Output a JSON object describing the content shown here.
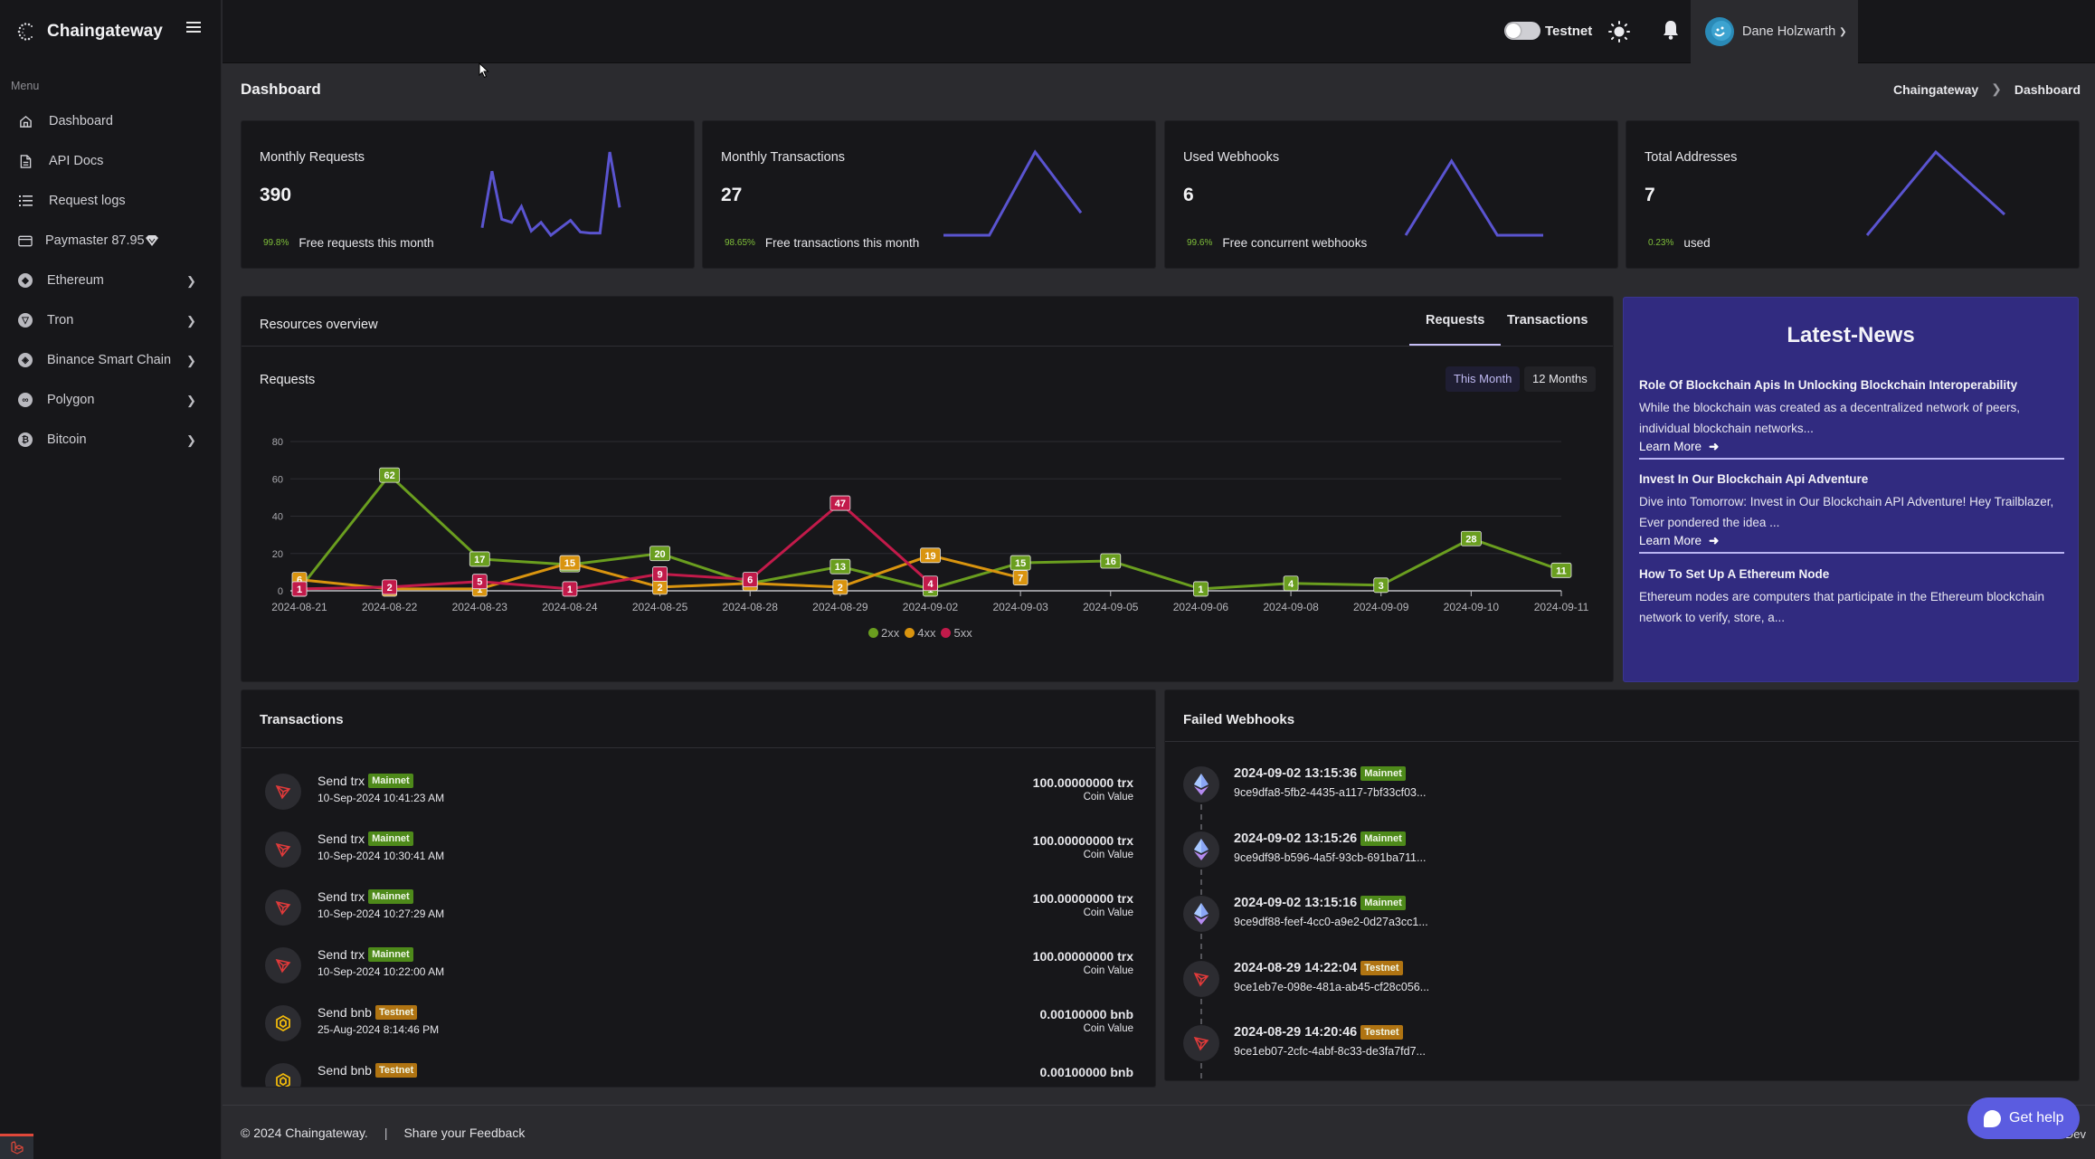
{
  "app": {
    "name": "Chaingateway"
  },
  "sidebar": {
    "menu_label": "Menu",
    "items": [
      {
        "label": "Dashboard",
        "icon": "home-icon",
        "has_submenu": false
      },
      {
        "label": "API Docs",
        "icon": "document-icon",
        "has_submenu": false
      },
      {
        "label": "Request logs",
        "icon": "list-icon",
        "has_submenu": false
      },
      {
        "label": "Paymaster 87.95",
        "icon": "credit-card-icon",
        "suffix_icon": "tron-diamond-icon",
        "has_submenu": false
      },
      {
        "label": "Ethereum",
        "icon": "ethereum-icon",
        "has_submenu": true
      },
      {
        "label": "Tron",
        "icon": "tron-icon",
        "has_submenu": true
      },
      {
        "label": "Binance Smart Chain",
        "icon": "bnb-icon",
        "has_submenu": true
      },
      {
        "label": "Polygon",
        "icon": "polygon-icon",
        "has_submenu": true
      },
      {
        "label": "Bitcoin",
        "icon": "bitcoin-icon",
        "has_submenu": true
      }
    ]
  },
  "topbar": {
    "network_toggle_label": "Testnet",
    "network_toggle_on": false,
    "user_name": "Dane Holzwarth"
  },
  "page": {
    "title": "Dashboard",
    "breadcrumb": [
      "Chaingateway",
      "Dashboard"
    ]
  },
  "stats": [
    {
      "title": "Monthly Requests",
      "value": "390",
      "pct": "99.8%",
      "desc": "Free requests this month",
      "spark": [
        9,
        62,
        17,
        14,
        29,
        6,
        14,
        2,
        9,
        16,
        5,
        4,
        4,
        80,
        28
      ]
    },
    {
      "title": "Monthly Transactions",
      "value": "27",
      "pct": "98.65%",
      "desc": "Free transactions this month",
      "spark": [
        0,
        0,
        26,
        7
      ]
    },
    {
      "title": "Used Webhooks",
      "value": "6",
      "pct": "99.6%",
      "desc": "Free concurrent webhooks",
      "spark": [
        0,
        3,
        0,
        0
      ]
    },
    {
      "title": "Total Addresses",
      "value": "7",
      "pct": "0.23%",
      "desc": "used",
      "spark": [
        1,
        5,
        2
      ]
    }
  ],
  "resources": {
    "title": "Resources overview",
    "tabs": [
      "Requests",
      "Transactions"
    ],
    "active_tab": "Requests",
    "subtitle": "Requests",
    "ranges": [
      "This Month",
      "12 Months"
    ],
    "active_range": "This Month"
  },
  "chart_data": {
    "type": "line",
    "title": "Requests",
    "xlabel": "",
    "ylabel": "",
    "ylim": [
      0,
      80
    ],
    "yticks": [
      0,
      20,
      40,
      60,
      80
    ],
    "grid": true,
    "legend": "bottom-center",
    "categories": [
      "2024-08-21",
      "2024-08-22",
      "2024-08-23",
      "2024-08-24",
      "2024-08-25",
      "2024-08-28",
      "2024-08-29",
      "2024-09-02",
      "2024-09-03",
      "2024-09-05",
      "2024-09-06",
      "2024-09-08",
      "2024-09-09",
      "2024-09-10",
      "2024-09-11"
    ],
    "series": [
      {
        "name": "2xx",
        "color": "#6a9e1f",
        "values": [
          1,
          62,
          17,
          14,
          20,
          4,
          13,
          1,
          15,
          16,
          1,
          4,
          3,
          28,
          11
        ]
      },
      {
        "name": "4xx",
        "color": "#d9940f",
        "values": [
          6,
          1,
          1,
          15,
          2,
          4,
          2,
          19,
          7,
          null,
          null,
          null,
          null,
          null,
          null
        ]
      },
      {
        "name": "5xx",
        "color": "#c21a4a",
        "values": [
          1,
          2,
          5,
          1,
          9,
          6,
          47,
          4,
          null,
          null,
          null,
          null,
          null,
          null,
          null
        ]
      }
    ]
  },
  "news": {
    "title": "Latest-News",
    "items": [
      {
        "title": "Role Of Blockchain Apis In Unlocking Blockchain Interoperability",
        "excerpt": "While the blockchain was created as a decentralized network of peers, individual blockchain networks...",
        "link": "Learn More"
      },
      {
        "title": "Invest In Our Blockchain Api Adventure",
        "excerpt": "Dive into Tomorrow: Invest in Our Blockchain API Adventure! Hey Trailblazer, Ever pondered the idea ...",
        "link": "Learn More"
      },
      {
        "title": "How To Set Up A Ethereum Node",
        "excerpt": "Ethereum nodes are computers that participate in the Ethereum blockchain network to verify, store, a..."
      }
    ]
  },
  "transactions": {
    "title": "Transactions",
    "items": [
      {
        "coin": "tron",
        "title": "Send trx",
        "network": "Mainnet",
        "time": "10-Sep-2024 10:41:23 AM",
        "amount": "100.00000000 trx",
        "sub": "Coin Value"
      },
      {
        "coin": "tron",
        "title": "Send trx",
        "network": "Mainnet",
        "time": "10-Sep-2024 10:30:41 AM",
        "amount": "100.00000000 trx",
        "sub": "Coin Value"
      },
      {
        "coin": "tron",
        "title": "Send trx",
        "network": "Mainnet",
        "time": "10-Sep-2024 10:27:29 AM",
        "amount": "100.00000000 trx",
        "sub": "Coin Value"
      },
      {
        "coin": "tron",
        "title": "Send trx",
        "network": "Mainnet",
        "time": "10-Sep-2024 10:22:00 AM",
        "amount": "100.00000000 trx",
        "sub": "Coin Value"
      },
      {
        "coin": "bnb",
        "title": "Send bnb",
        "network": "Testnet",
        "time": "25-Aug-2024 8:14:46 PM",
        "amount": "0.00100000 bnb",
        "sub": "Coin Value"
      },
      {
        "coin": "bnb",
        "title": "Send bnb",
        "network": "Testnet",
        "time": "",
        "amount": "0.00100000 bnb",
        "sub": ""
      }
    ]
  },
  "webhooks": {
    "title": "Failed Webhooks",
    "items": [
      {
        "coin": "ethereum",
        "time": "2024-09-02 13:15:36",
        "network": "Mainnet",
        "id": "9ce9dfa8-5fb2-4435-a117-7bf33cf03..."
      },
      {
        "coin": "ethereum",
        "time": "2024-09-02 13:15:26",
        "network": "Mainnet",
        "id": "9ce9df98-b596-4a5f-93cb-691ba711..."
      },
      {
        "coin": "ethereum",
        "time": "2024-09-02 13:15:16",
        "network": "Mainnet",
        "id": "9ce9df88-feef-4cc0-a9e2-0d27a3cc1..."
      },
      {
        "coin": "tron",
        "time": "2024-08-29 14:22:04",
        "network": "Testnet",
        "id": "9ce1eb7e-098e-481a-ab45-cf28c056..."
      },
      {
        "coin": "tron",
        "time": "2024-08-29 14:20:46",
        "network": "Testnet",
        "id": "9ce1eb07-2cfc-4abf-8c33-de3fa7fd7..."
      }
    ]
  },
  "footer": {
    "copyright": "© 2024 Chaingateway.",
    "separator": "|",
    "feedback": "Share your Feedback",
    "right_text": "Dev"
  },
  "help_button": "Get help",
  "colors": {
    "accent": "#5b5ce0",
    "sparkline": "#5a54d0",
    "news_bg": "#312b80",
    "mainnet": "#4e8a1a",
    "testnet": "#b07412"
  }
}
